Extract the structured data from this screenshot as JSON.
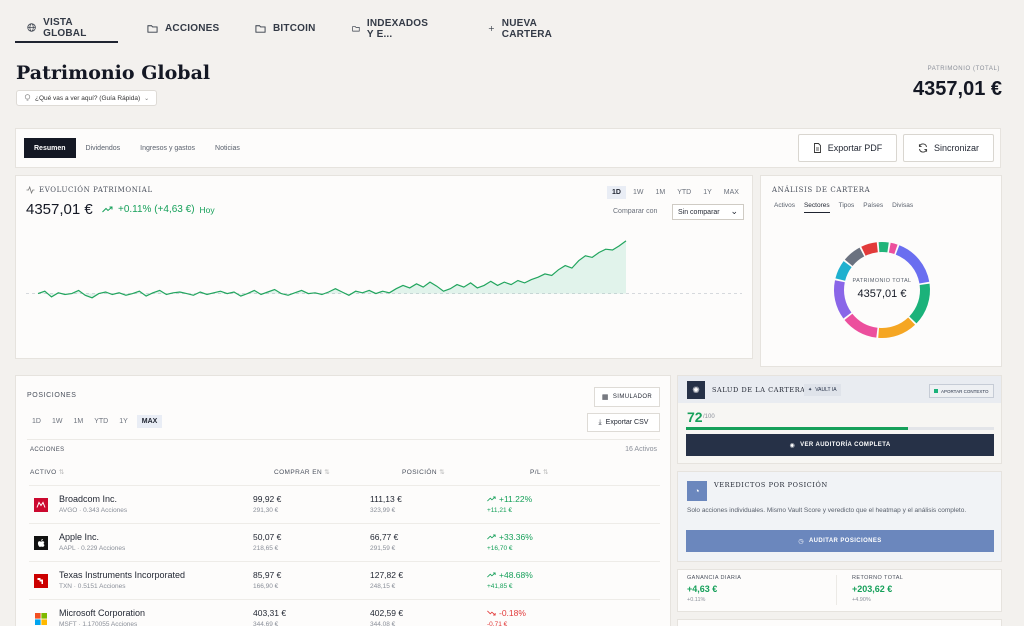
{
  "tabs": [
    {
      "label": "VISTA GLOBAL",
      "icon": "globe-icon"
    },
    {
      "label": "ACCIONES",
      "icon": "folder-icon"
    },
    {
      "label": "BITCOIN",
      "icon": "folder-icon"
    },
    {
      "label": "INDEXADOS Y E...",
      "icon": "folder-icon"
    },
    {
      "label": "NUEVA CARTERA",
      "icon": "plus-icon"
    }
  ],
  "header": {
    "title": "Patrimonio Global",
    "guide": "¿Qué vas a ver aquí? (Guía Rápida)",
    "total_label": "PATRIMONIO (TOTAL)",
    "total_value": "4357,01 €"
  },
  "subtabs": [
    "Resumen",
    "Dividendos",
    "Ingresos y gastos",
    "Noticias"
  ],
  "actions": {
    "export_pdf": "Exportar PDF",
    "sync": "Sincronizar"
  },
  "evolution": {
    "title": "EVOLUCIÓN PATRIMONIAL",
    "value": "4357,01 €",
    "change": "+0.11% (+4,63 €)",
    "period": "Hoy",
    "ranges": [
      "1D",
      "1W",
      "1M",
      "YTD",
      "1Y",
      "MAX"
    ],
    "compare_label": "Comparar con",
    "compare_value": "Sin comparar",
    "series": [
      40,
      43,
      36,
      41,
      39,
      40,
      44,
      38,
      35,
      40,
      42,
      39,
      41,
      38,
      40,
      43,
      37,
      41,
      44,
      39,
      41,
      42,
      40,
      38,
      42,
      39,
      41,
      43,
      40,
      42,
      37,
      40,
      44,
      39,
      42,
      45,
      40,
      38,
      41,
      44,
      40,
      41,
      39,
      42,
      46,
      42,
      38,
      43,
      41,
      44,
      40,
      43,
      41,
      46,
      50,
      47,
      52,
      48,
      54,
      49,
      43,
      46,
      51,
      48,
      53,
      47,
      50,
      55,
      50,
      54,
      51,
      56,
      53,
      57,
      60,
      64,
      62,
      69,
      74,
      71,
      80,
      86,
      84,
      90,
      94,
      93,
      98,
      104
    ]
  },
  "analysis": {
    "title": "ANÁLISIS DE CARTERA",
    "tabs": [
      "Activos",
      "Sectores",
      "Tipos",
      "Países",
      "Divisas"
    ],
    "center_label": "PATRIMONIO TOTAL",
    "center_value": "4357,01 €",
    "segments": [
      {
        "value": 17,
        "color": "#6a6ef0"
      },
      {
        "value": 15,
        "color": "#1bb27a"
      },
      {
        "value": 14,
        "color": "#f5a623"
      },
      {
        "value": 13,
        "color": "#ec4f9d"
      },
      {
        "value": 14,
        "color": "#8a66e8"
      },
      {
        "value": 7,
        "color": "#1fb0cf"
      },
      {
        "value": 7,
        "color": "#6b7280"
      },
      {
        "value": 6,
        "color": "#e23a3a"
      },
      {
        "value": 4,
        "color": "#22b47a"
      },
      {
        "value": 3,
        "color": "#ec4f9d"
      }
    ]
  },
  "positions": {
    "title": "POSICIONES",
    "simulator": "SIMULADOR",
    "export_csv": "Exportar CSV",
    "ranges": [
      "1D",
      "1W",
      "1M",
      "YTD",
      "1Y",
      "MAX"
    ],
    "section": "ACCIONES",
    "count": "16 Activos",
    "columns": [
      "ACTIVO",
      "COMPRAR EN",
      "POSICIÓN",
      "P/L"
    ],
    "rows": [
      {
        "name": "Broadcom Inc.",
        "sub": "AVGO · 0.343 Acciones",
        "buy": "99,92 €",
        "buy_sub": "291,30 €",
        "pos": "111,13 €",
        "pos_sub": "323,99 €",
        "pl": "+11.22%",
        "pl_sub": "+11,21 €",
        "dir": "up",
        "logo_color": "#cc092f"
      },
      {
        "name": "Apple Inc.",
        "sub": "AAPL · 0.229 Acciones",
        "buy": "50,07 €",
        "buy_sub": "218,65 €",
        "pos": "66,77 €",
        "pos_sub": "291,59 €",
        "pl": "+33.36%",
        "pl_sub": "+16,70 €",
        "dir": "up",
        "logo_color": "#111111"
      },
      {
        "name": "Texas Instruments Incorporated",
        "sub": "TXN · 0.5151 Acciones",
        "buy": "85,97 €",
        "buy_sub": "166,90 €",
        "pos": "127,82 €",
        "pos_sub": "248,15 €",
        "pl": "+48.68%",
        "pl_sub": "+41,85 €",
        "dir": "up",
        "logo_color": "#cc0000"
      },
      {
        "name": "Microsoft Corporation",
        "sub": "MSFT · 1.170055 Acciones",
        "buy": "403,31 €",
        "buy_sub": "344,69 €",
        "pos": "402,59 €",
        "pos_sub": "344,08 €",
        "pl": "-0.18%",
        "pl_sub": "-0,71 €",
        "dir": "down",
        "logo_color": "#f25022"
      }
    ]
  },
  "health": {
    "title": "SALUD DE LA CARTERA",
    "badge": "VAULT IA",
    "contrast": "APORTAR CONTEXTO",
    "score": "72",
    "score_max": "/100",
    "score_fraction": 0.72,
    "audit": "VER AUDITORÍA COMPLETA"
  },
  "verdicts": {
    "title": "VEREDICTOS POR POSICIÓN",
    "text": "Solo acciones individuales. Mismo Vault Score y veredicto que el heatmap y el análisis completo.",
    "button": "AUDITAR POSICIONES"
  },
  "stats": {
    "daily_label": "GANANCIA DIARIA",
    "daily_value": "+4,63 €",
    "daily_pct": "+0.11%",
    "total_label": "RETORNO TOTAL",
    "total_value": "+203,62 €",
    "total_pct": "+4.90%"
  }
}
